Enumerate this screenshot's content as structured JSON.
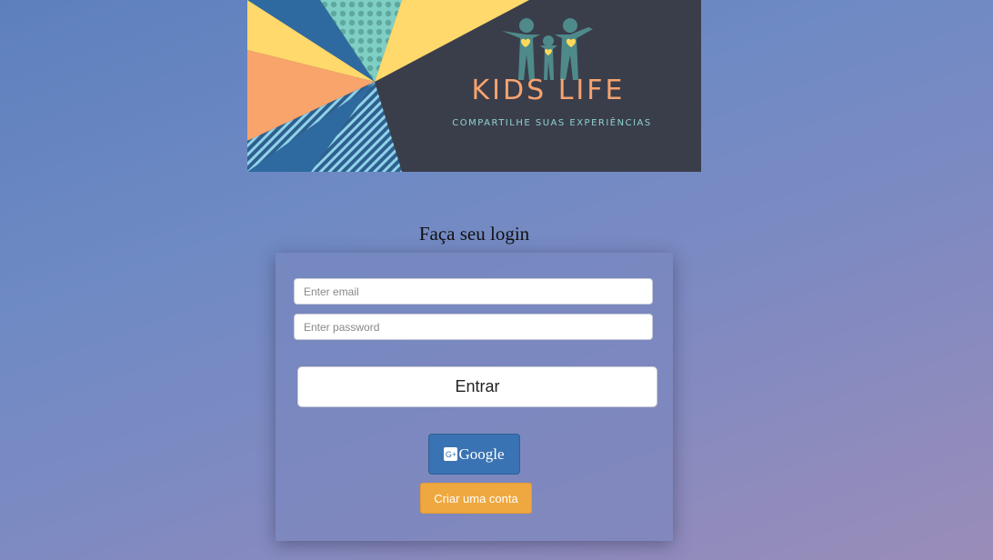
{
  "banner": {
    "title": "KIDS LIFE",
    "subtitle": "COMPARTILHE SUAS EXPERIÊNCIAS",
    "colors": {
      "background": "#3a3e4b",
      "title": "#f6a36f",
      "subtitle": "#8fd3cf",
      "figures": "#4f8a8b",
      "hearts": "#ffd95a"
    }
  },
  "login": {
    "heading": "Faça seu login",
    "email_placeholder": "Enter email",
    "email_value": "",
    "password_placeholder": "Enter password",
    "password_value": "",
    "submit_label": "Entrar",
    "google_icon_glyph": "G+",
    "google_label": "Google",
    "create_account_label": "Criar uma conta"
  },
  "colors": {
    "google_button": "#3a73b3",
    "create_account_button": "#efa83f"
  }
}
